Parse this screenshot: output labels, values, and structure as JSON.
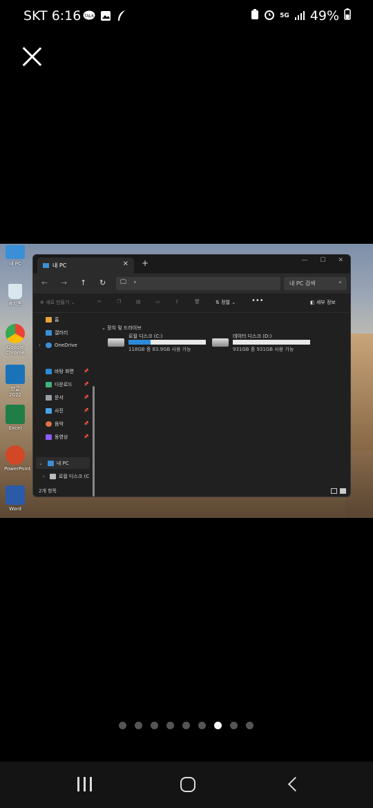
{
  "status_bar": {
    "carrier_time": "SKT 6:16",
    "network": "5G",
    "battery": "49%",
    "left_icons": [
      "talk-icon",
      "gallery-icon",
      "feather-icon"
    ],
    "right_icons": [
      "lock-battery-icon",
      "alarm-icon",
      "signal-icon",
      "battery-icon"
    ]
  },
  "viewer": {
    "close_icon": "close-icon",
    "page_count": 9,
    "active_page": 7
  },
  "desktop_icons": [
    {
      "label": "내 PC"
    },
    {
      "label": "휴지통"
    },
    {
      "label": "Google Chrome"
    },
    {
      "label": "한글 2022"
    },
    {
      "label": "Excel"
    },
    {
      "label": "PowerPoint"
    },
    {
      "label": "Word"
    }
  ],
  "explorer": {
    "tab_title": "내 PC",
    "search_placeholder": "내 PC 검색",
    "new_label": "새로 만들기",
    "sort_label": "정렬",
    "details_label": "세부 정보",
    "sidebar": {
      "home": "홈",
      "gallery": "갤러리",
      "onedrive": "OneDrive",
      "quick": [
        {
          "label": "바탕 화면",
          "color": "#2d8ad8"
        },
        {
          "label": "다운로드",
          "color": "#3fb27f"
        },
        {
          "label": "문서",
          "color": "#9aa0a6"
        },
        {
          "label": "사진",
          "color": "#4aa3e8"
        },
        {
          "label": "음악",
          "color": "#e0724a"
        },
        {
          "label": "동영상",
          "color": "#8b5cf6"
        }
      ],
      "this_pc": "내 PC",
      "local_disk": "로컬 디스크 (C"
    },
    "group_title": "장치 및 드라이브",
    "drives": [
      {
        "name": "로컬 디스크 (C:)",
        "size": "118GB 중 83.9GB 사용 가능",
        "used_fraction": 0.29
      },
      {
        "name": "데이터 디스크 (D:)",
        "size": "931GB 중 931GB 사용 가능",
        "used_fraction": 0.0
      }
    ],
    "item_count": "2개 항목"
  },
  "colors": {
    "accent": "#2d8ad8",
    "window_bg": "#202020"
  }
}
